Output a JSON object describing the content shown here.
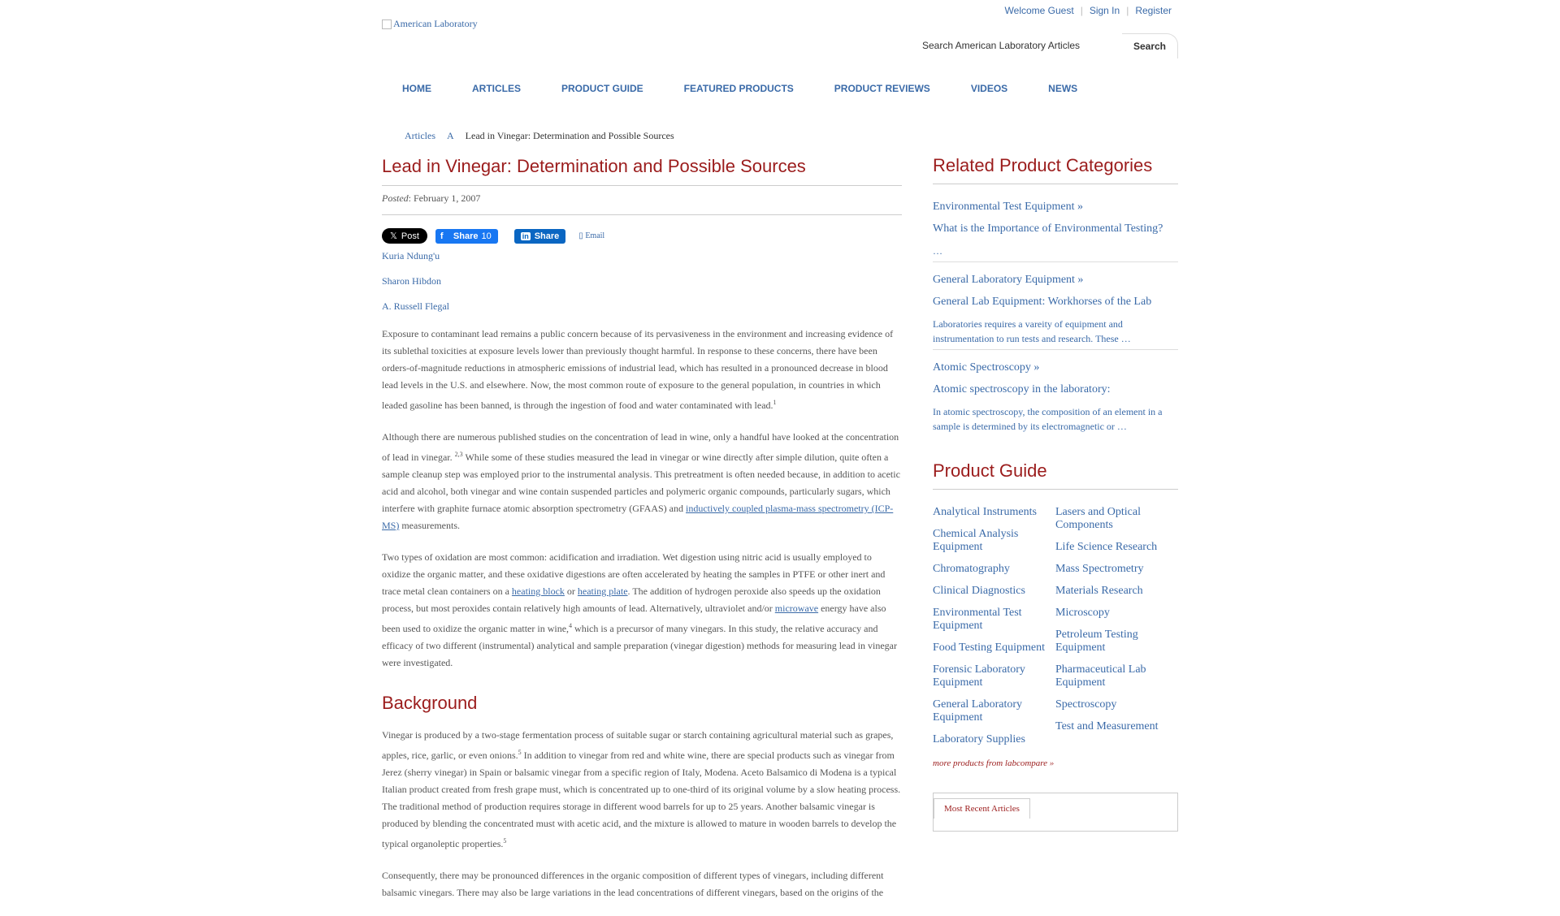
{
  "header": {
    "logo_alt": "American Laboratory",
    "welcome": "Welcome Guest",
    "sign_in": "Sign In",
    "register": "Register",
    "search_placeholder": "Search American Laboratory Articles",
    "search_button": "Search"
  },
  "nav": [
    "HOME",
    "ARTICLES",
    "PRODUCT GUIDE",
    "FEATURED PRODUCTS",
    "PRODUCT REVIEWS",
    "VIDEOS",
    "NEWS"
  ],
  "breadcrumb": {
    "items": [
      "Articles",
      "A"
    ],
    "current": "Lead in Vinegar: Determination and Possible Sources"
  },
  "article": {
    "title": "Lead in Vinegar: Determination and Possible Sources",
    "posted_label": "Posted",
    "posted_date": ": February 1, 2007",
    "share": {
      "x_label": "Post",
      "fb_label": "Share",
      "fb_count": "10",
      "li_label": "Share",
      "email_label": "Email"
    },
    "authors": [
      "Kuria Ndung'u",
      "Sharon Hibdon",
      "A. Russell Flegal"
    ],
    "p1": "Exposure to contaminant lead remains a public concern because of its pervasiveness in the environment and increasing evidence of its sublethal toxicities at exposure levels lower than previously thought harmful. In response to these concerns, there have been orders-of-magnitude reductions in atmospheric emissions of industrial lead, which has resulted in a pronounced decrease in blood lead levels in the U.S. and elsewhere. Now, the most common route of exposure to the general population, in countries in which leaded gasoline has been banned, is through the ingestion of food and water contaminated with lead.",
    "p1_sup": "1",
    "p2_a": "Although there are numerous published studies on the concentration of lead in wine, only a handful have looked at the concentration of lead in vinegar.",
    "p2_sup": "2,3",
    "p2_b": "While some of these studies measured the lead in vinegar or wine directly after simple dilution, quite often a sample cleanup step was employed prior to the instrumental analysis. This pretreatment is often needed because, in addition to acetic acid and alcohol, both vinegar and wine contain suspended particles and polymeric organic compounds, particularly sugars, which interfere with graphite furnace atomic absorption spectrometry (GFAAS) and",
    "p2_link": "inductively coupled plasma-mass spectrometry (ICP-MS)",
    "p2_c": "measurements.",
    "p3_a": "Two types of oxidation are most common: acidification and irradiation. Wet digestion using nitric acid is usually employed to oxidize the organic matter, and these oxidative digestions are often accelerated by heating the samples in PTFE or other inert and trace metal clean containers on a",
    "p3_link1": "heating block",
    "p3_or": "or",
    "p3_link2": "heating plate",
    "p3_b": ". The addition of hydrogen peroxide also speeds up the oxidation process, but most peroxides contain relatively high amounts of lead. Alternatively, ultraviolet and/or",
    "p3_link3": "microwave",
    "p3_c": "energy have also been used to oxidize the organic matter in wine,",
    "p3_sup": "4",
    "p3_d": "which is a precursor of many vinegars. In this study, the relative accuracy and efficacy of two different (instrumental) analytical and sample preparation (vinegar digestion) methods for measuring lead in vinegar were investigated.",
    "h_background": "Background",
    "p4_a": "Vinegar is produced by a two-stage fermentation process of suitable sugar or starch containing agricultural material such as grapes, apples, rice, garlic, or even onions.",
    "p4_sup": "5",
    "p4_b": "In addition to vinegar from red and white wine, there are special products such as vinegar from Jerez (sherry vinegar) in Spain or balsamic vinegar from a specific region of Italy, Modena. Aceto Balsamico di Modena is a typical Italian product created from fresh grape must, which is concentrated up to one-third of its original volume by a slow heating process. The traditional method of production requires storage in different wood barrels for up to 25 years. Another balsamic vinegar is produced by blending the concentrated must with acetic acid, and the mixture is allowed to mature in wooden barrels to develop the typical organoleptic properties.",
    "p4_sup2": "5",
    "p5": "Consequently, there may be pronounced differences in the organic composition of different types of vinegars, including different balsamic vinegars. There may also be large variations in the lead concentrations of different vinegars, based on the origins of the"
  },
  "sidebar": {
    "related_title": "Related Product Categories",
    "related": [
      {
        "category": "Environmental Test Equipment »",
        "article": "What is the Importance of Environmental Testing?",
        "desc": "…"
      },
      {
        "category": "General Laboratory Equipment »",
        "article": "General Lab Equipment: Workhorses of the Lab",
        "desc": "Laboratories requires a vareity of equipment and instrumentation to run tests and research. These …"
      },
      {
        "category": "Atomic Spectroscopy »",
        "article": "Atomic spectroscopy in the laboratory:",
        "desc": "In atomic spectroscopy, the composition of an element in a sample is determined by its electromagnetic or …"
      }
    ],
    "product_guide_title": "Product Guide",
    "pg_col1": [
      "Analytical Instruments",
      "Chemical Analysis Equipment",
      "Chromatography",
      "Clinical Diagnostics",
      "Environmental Test Equipment",
      "Food Testing Equipment",
      "Forensic Laboratory Equipment",
      "General Laboratory Equipment",
      "Laboratory Supplies"
    ],
    "pg_col2": [
      "Lasers and Optical Components",
      "Life Science Research",
      "Mass Spectrometry",
      "Materials Research",
      "Microscopy",
      "Petroleum Testing Equipment",
      "Pharmaceutical Lab Equipment",
      "Spectroscopy",
      "Test and Measurement"
    ],
    "more_products": "more products from labcompare »",
    "recent_tab": "Most Recent Articles"
  }
}
